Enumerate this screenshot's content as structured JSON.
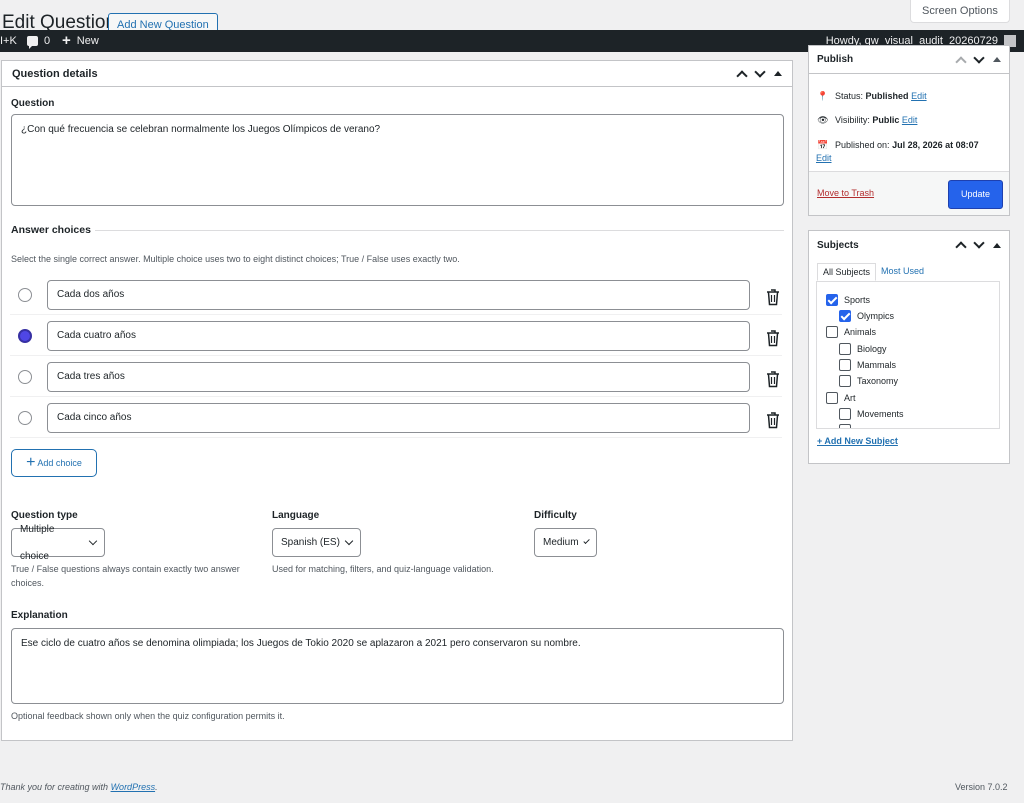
{
  "header": {
    "title": "Edit Question",
    "add_new_label": "Add New Question",
    "screen_options_label": "Screen Options"
  },
  "adminbar": {
    "shortcut": "I+K",
    "comments_count": "0",
    "new_label": "New",
    "howdy": "Howdy, qw_visual_audit_20260729"
  },
  "question_box": {
    "title": "Question details",
    "question_label": "Question",
    "question_text": "¿Con qué frecuencia se celebran normalmente los Juegos Olímpicos de verano?",
    "answers_label": "Answer choices",
    "answers_help": "Select the single correct answer. Multiple choice uses two to eight distinct choices; True / False uses exactly two.",
    "choices": [
      {
        "text": "Cada dos años",
        "correct": false
      },
      {
        "text": "Cada cuatro años",
        "correct": true
      },
      {
        "text": "Cada tres años",
        "correct": false
      },
      {
        "text": "Cada cinco años",
        "correct": false
      }
    ],
    "add_choice_label": "Add choice",
    "type_label": "Question type",
    "type_value": "Multiple choice",
    "type_help": "True / False questions always contain exactly two answer choices.",
    "language_label": "Language",
    "language_value": "Spanish (ES)",
    "language_help": "Used for matching, filters, and quiz-language validation.",
    "difficulty_label": "Difficulty",
    "difficulty_value": "Medium",
    "explanation_label": "Explanation",
    "explanation_text": "Ese ciclo de cuatro años se denomina olimpiada; los Juegos de Tokio 2020 se aplazaron a 2021 pero conservaron su nombre.",
    "explanation_help": "Optional feedback shown only when the quiz configuration permits it."
  },
  "publish": {
    "title": "Publish",
    "status_label": "Status:",
    "status_value": "Published",
    "visibility_label": "Visibility:",
    "visibility_value": "Public",
    "published_label": "Published on:",
    "published_value": "Jul 28, 2026 at 08:07",
    "edit_label": "Edit",
    "trash_label": "Move to Trash",
    "update_label": "Update"
  },
  "subjects": {
    "title": "Subjects",
    "tab_all": "All Subjects",
    "tab_used": "Most Used",
    "items": [
      {
        "label": "Sports",
        "checked": true,
        "level": 0
      },
      {
        "label": "Olympics",
        "checked": true,
        "level": 1
      },
      {
        "label": "Animals",
        "checked": false,
        "level": 0
      },
      {
        "label": "Biology",
        "checked": false,
        "level": 1
      },
      {
        "label": "Mammals",
        "checked": false,
        "level": 1
      },
      {
        "label": "Taxonomy",
        "checked": false,
        "level": 1
      },
      {
        "label": "Art",
        "checked": false,
        "level": 0
      },
      {
        "label": "Movements",
        "checked": false,
        "level": 1
      }
    ],
    "add_new_label": "+ Add New Subject"
  },
  "footer": {
    "thanks_prefix": "Thank you for creating with ",
    "wp_link": "WordPress",
    "thanks_suffix": ".",
    "version": "Version 7.0.2"
  },
  "colors": {
    "accent": "#2563eb",
    "link": "#2271b1",
    "danger": "#b32d2e",
    "radio_selected": "#4f46e5"
  }
}
